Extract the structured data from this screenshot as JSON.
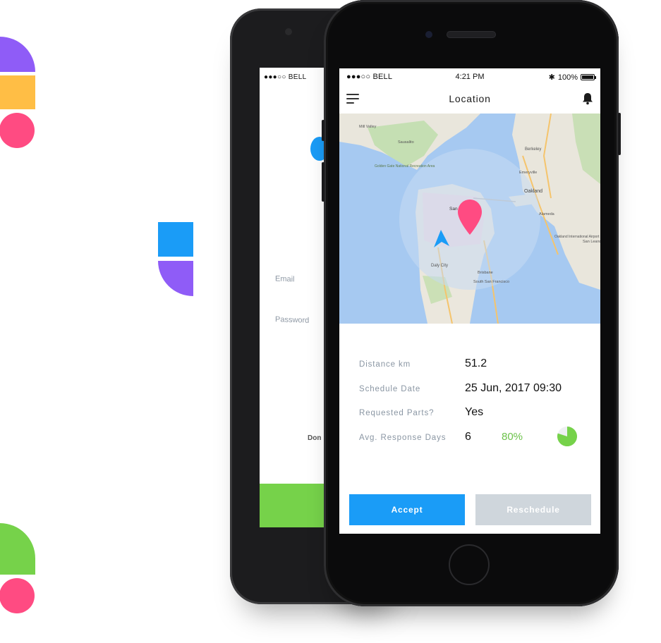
{
  "colors": {
    "purple": "#8f5cf7",
    "yellow": "#ffbe45",
    "pink": "#ff4b82",
    "blue": "#1a9cf7",
    "green": "#76d24a",
    "accent_green": "#6cc24a",
    "disabled": "#cfd6dc"
  },
  "back_phone": {
    "status": {
      "carrier": "●●●○○ BELL"
    },
    "email_label": "Email",
    "password_label": "Password",
    "partial_link": "Don"
  },
  "front_phone": {
    "status": {
      "carrier": "●●●○○ BELL",
      "time": "4:21 PM",
      "battery": "100%"
    },
    "header": {
      "title": "Location",
      "menu_icon": "hamburger-icon",
      "bell_icon": "bell-icon"
    },
    "map": {
      "labels": [
        "Berkeley",
        "Emeryville",
        "Oakland",
        "Alameda",
        "Oakland International Airport",
        "San Leandro",
        "Daly City",
        "South San Francisco",
        "Brisbane",
        "San Francisco",
        "Sausalito",
        "Mill Valley",
        "Golden Gate National Recreation Area"
      ]
    },
    "details": [
      {
        "label": "Distance km",
        "value": "51.2"
      },
      {
        "label": "Schedule Date",
        "value": "25 Jun, 2017 09:30"
      },
      {
        "label": "Requested Parts?",
        "value": "Yes"
      },
      {
        "label": "Avg. Response Days",
        "value": "6",
        "percent": "80%",
        "pie_fraction": 0.8
      }
    ],
    "buttons": {
      "accept": "Accept",
      "reschedule": "Reschedule"
    }
  }
}
